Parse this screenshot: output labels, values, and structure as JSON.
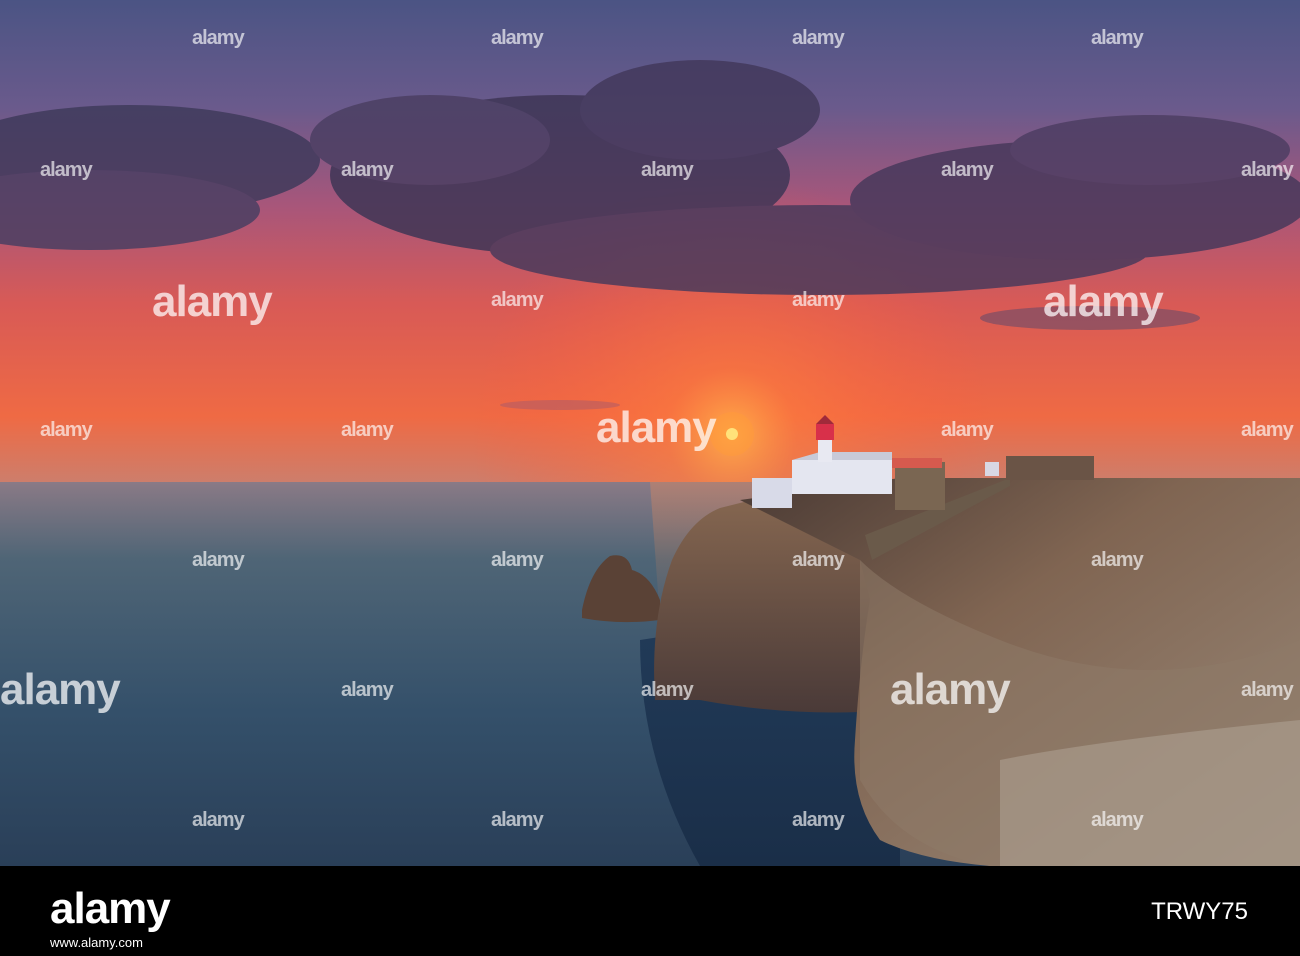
{
  "image": {
    "subject": "sunset-over-sea-cliff-with-lighthouse",
    "palette": {
      "sky_top": "#4a4f7e",
      "sky_mid": "#b0506a",
      "horizon": "#f0613e",
      "sun": "#ffd24a",
      "sea": "#3d5566",
      "cliff": "#7a5a46"
    }
  },
  "watermark": {
    "text": "alamy"
  },
  "footer": {
    "logo": "alamy",
    "image_id": "TRWY75",
    "url": "www.alamy.com"
  }
}
